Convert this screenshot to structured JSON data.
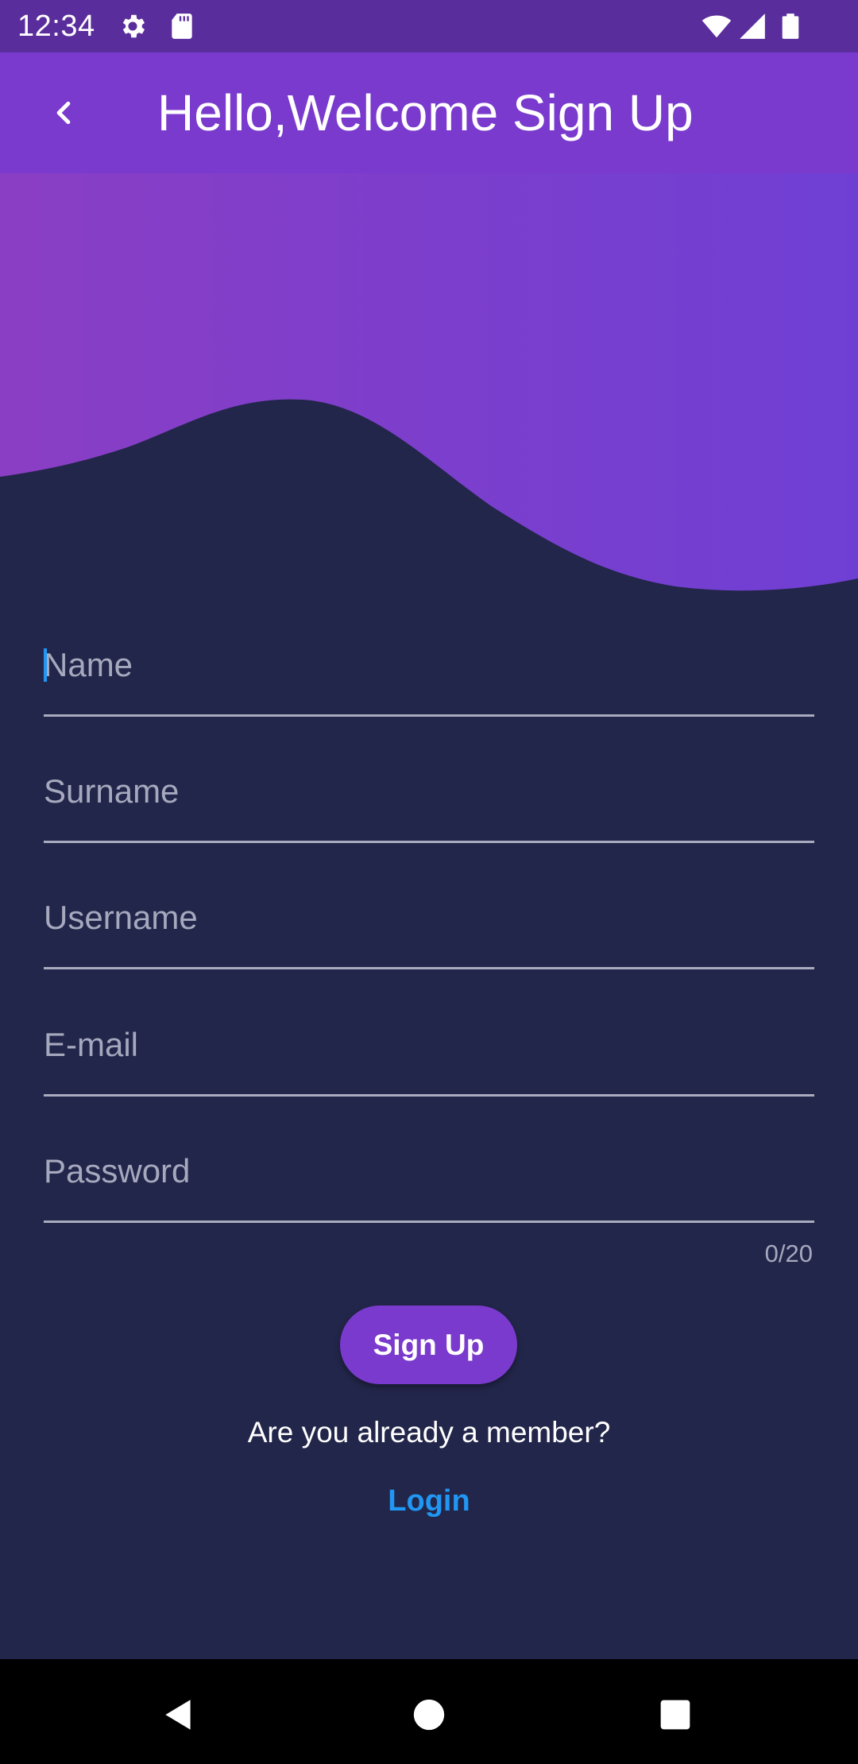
{
  "status_bar": {
    "time": "12:34",
    "left_icons": [
      "gear-icon",
      "sd-card-icon"
    ],
    "right_icons": [
      "wifi-icon",
      "cell-signal-icon",
      "battery-icon"
    ]
  },
  "app_bar": {
    "title": "Hello,Welcome Sign Up",
    "back_icon": "chevron-left-icon"
  },
  "colors": {
    "status_bar": "#5a2d9c",
    "app_bar": "#7a3acd",
    "wave_start": "#8a3ec4",
    "wave_end": "#6f3fd4",
    "background": "#22264a",
    "accent": "#2196f3",
    "button": "#7a3acd"
  },
  "form": {
    "fields": [
      {
        "placeholder": "Name",
        "value": ""
      },
      {
        "placeholder": "Surname",
        "value": ""
      },
      {
        "placeholder": "Username",
        "value": ""
      },
      {
        "placeholder": "E-mail",
        "value": ""
      },
      {
        "placeholder": "Password",
        "value": ""
      }
    ],
    "password_counter": "0/20",
    "submit_label": "Sign Up",
    "member_prompt": "Are you already a member?",
    "login_label": "Login"
  },
  "nav_bar": {
    "buttons": [
      "back-triangle-icon",
      "home-circle-icon",
      "recents-square-icon"
    ]
  }
}
